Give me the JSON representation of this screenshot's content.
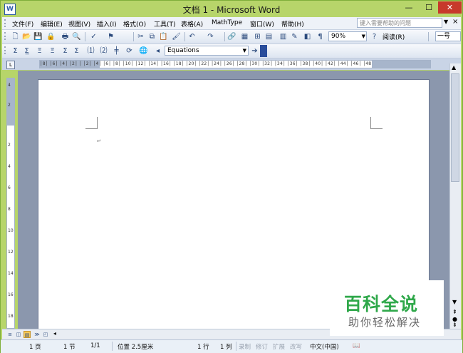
{
  "window": {
    "title": "文档 1 - Microsoft Word",
    "minimize_label": "—",
    "maximize_label": "☐",
    "close_label": "✕"
  },
  "menubar": {
    "items": [
      {
        "label": "文件(F)"
      },
      {
        "label": "编辑(E)"
      },
      {
        "label": "视图(V)"
      },
      {
        "label": "插入(I)"
      },
      {
        "label": "格式(O)"
      },
      {
        "label": "工具(T)"
      },
      {
        "label": "表格(A)"
      },
      {
        "label": "MathType"
      },
      {
        "label": "窗口(W)"
      },
      {
        "label": "帮助(H)"
      }
    ],
    "help_placeholder": "键入需要帮助的问题",
    "help_close": "×"
  },
  "toolbar_standard": {
    "icons": [
      "new-icon",
      "open-icon",
      "save-icon",
      "permission-icon",
      "print-icon",
      "print-preview-icon",
      "spelling-icon",
      "research-icon",
      "cut-icon",
      "copy-icon",
      "paste-icon",
      "format-painter-icon",
      "undo-icon",
      "redo-icon",
      "hyperlink-icon",
      "tables-borders-icon",
      "insert-table-icon",
      "insert-excel-icon",
      "columns-icon",
      "drawing-icon",
      "document-map-icon",
      "show-hide-icon"
    ],
    "zoom_value": "90%",
    "read_label": "阅读(R)",
    "style_value": "一号"
  },
  "toolbar_mathtype": {
    "icons": [
      "sigma-icon",
      "sum-icon",
      "inline-eq-icon",
      "display-eq-icon",
      "right-number-icon",
      "left-number-icon",
      "insert-number-icon",
      "insert-ref-icon",
      "chapter-break-icon",
      "update-eq-icon",
      "equation-toggle-icon",
      "globe-icon"
    ],
    "equations_value": "Equations"
  },
  "ruler": {
    "h_text": "│8│ │6│ │4│ │2│ │ │2│ │4│ │6│ │8│ │10│ │12│ │14│ │16│ │18│ │20│ │22│ │24│ │26│ │28│ │30│ │32│ │34│ │36│ │38│ │40│ │42│ │44│ │46│ │48",
    "v_marks": [
      "4",
      "2",
      "2",
      "4",
      "6",
      "8",
      "10",
      "12",
      "14",
      "16",
      "18"
    ]
  },
  "document": {
    "paragraph_mark": "↵"
  },
  "statusbar": {
    "page": "1 页",
    "section": "1 节",
    "pages": "1/1",
    "position": "位置 2.5厘米",
    "line": "1 行",
    "column": "1 列",
    "rec": "录制",
    "trk": "修订",
    "ext": "扩展",
    "ovr": "改写",
    "language": "中文(中国)"
  },
  "watermark": {
    "main": "百科全说",
    "sub": "助你轻松解决"
  }
}
